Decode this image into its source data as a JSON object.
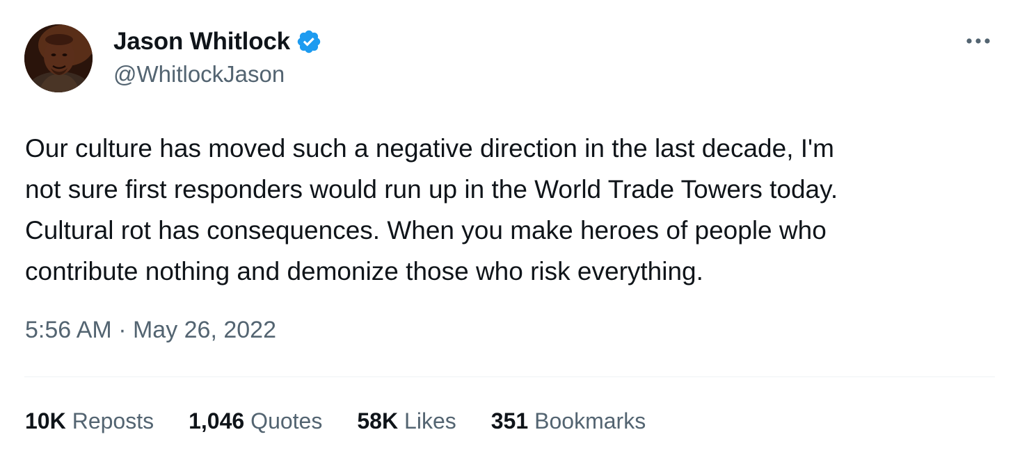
{
  "author": {
    "display_name": "Jason Whitlock",
    "handle": "@WhitlockJason",
    "verified": true,
    "avatar_icon": "profile-photo",
    "verified_icon": "verified-badge-icon",
    "verified_color": "#1d9bf0"
  },
  "menu": {
    "icon": "more-horizontal-icon"
  },
  "tweet": {
    "text": "Our culture has moved such a negative direction in the last decade, I'm\nnot sure first responders would run up in the World Trade Towers today.\nCultural rot has consequences. When you make heroes of people who\ncontribute nothing and demonize those who risk everything.",
    "timestamp": "5:56 AM · May 26, 2022"
  },
  "stats": [
    {
      "count": "10K",
      "label": "Reposts"
    },
    {
      "count": "1,046",
      "label": "Quotes"
    },
    {
      "count": "58K",
      "label": "Likes"
    },
    {
      "count": "351",
      "label": "Bookmarks"
    }
  ],
  "colors": {
    "text_primary": "#0f1419",
    "text_secondary": "#536471",
    "divider": "#eff3f4"
  }
}
